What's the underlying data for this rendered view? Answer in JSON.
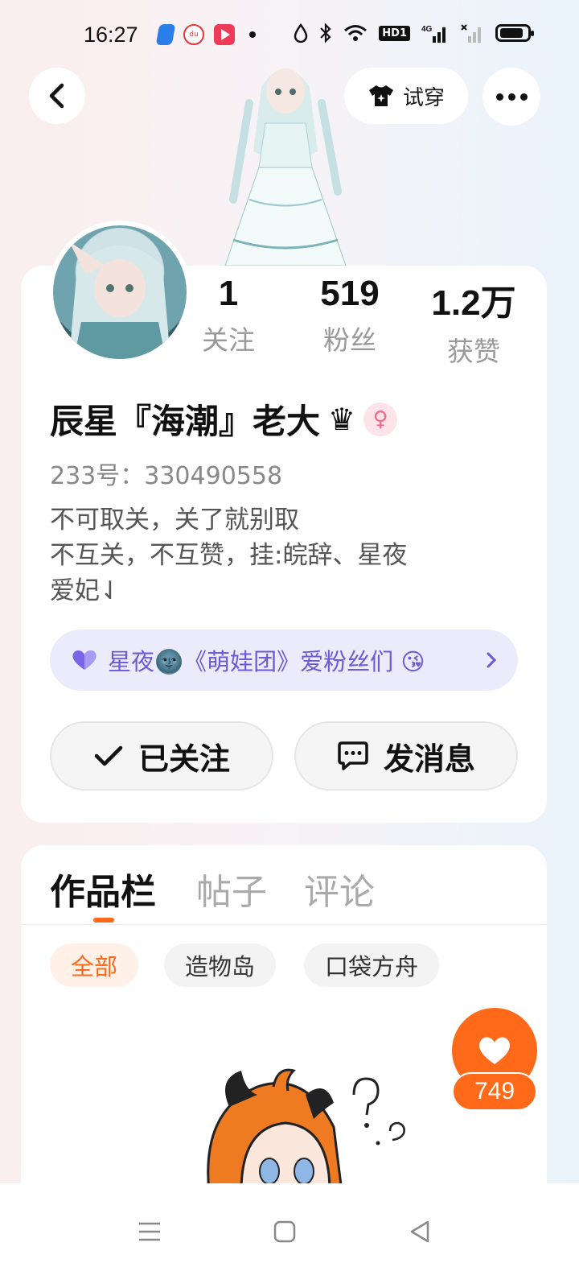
{
  "status_bar": {
    "time": "16:27",
    "du_label": "du",
    "hd_label": "HD1",
    "network_label": "4G",
    "icons": [
      "blue-app-icon",
      "du-app-icon",
      "video-app-icon",
      "dot-icon",
      "drop-icon",
      "bluetooth-icon",
      "wifi-icon",
      "hd-icon",
      "signal-4g-icon",
      "signal-empty-icon",
      "battery-icon"
    ]
  },
  "header": {
    "try_on_label": "试穿"
  },
  "profile": {
    "stats": [
      {
        "value": "1",
        "label": "关注"
      },
      {
        "value": "519",
        "label": "粉丝"
      },
      {
        "value": "1.2万",
        "label": "获赞"
      }
    ],
    "username": "辰星『海潮』老大",
    "crown": "♛",
    "gender_symbol": "♀",
    "uid": "233号：330490558",
    "bio_lines": [
      "不可取关，关了就别取",
      "不互关，不互赞，挂:皖辞、星夜",
      "爱妃⇃"
    ],
    "fan_group": "星夜🌚《萌娃团》爱粉丝们 😘",
    "followed_label": "已关注",
    "message_label": "发消息"
  },
  "works": {
    "tabs": [
      "作品栏",
      "帖子",
      "评论"
    ],
    "chips": [
      "全部",
      "造物岛",
      "口袋方舟"
    ],
    "like_count": "749"
  },
  "colors": {
    "accent": "#ff6a1a",
    "fan_purple": "#6b5ad6",
    "gender_pink": "#f06a8c"
  }
}
